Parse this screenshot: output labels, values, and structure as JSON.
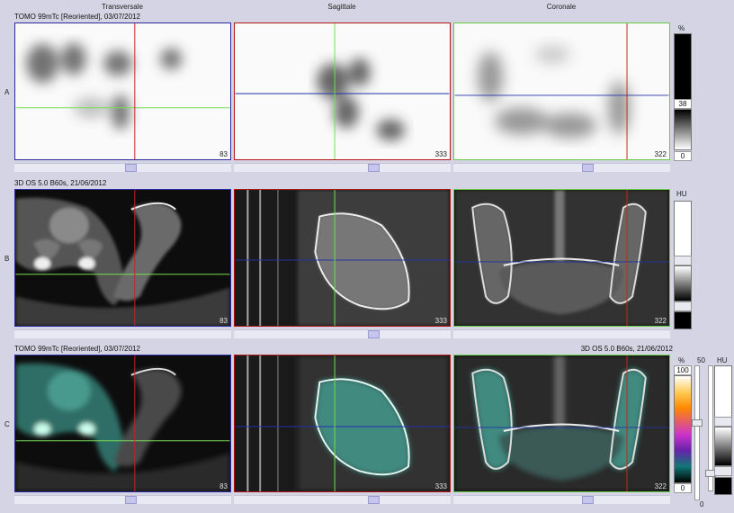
{
  "columns": {
    "transversale": "Transversale",
    "sagittale": "Sagittale",
    "coronale": "Coronale"
  },
  "row_labels": {
    "a": "A",
    "b": "B",
    "c": "C"
  },
  "series": {
    "a": "TOMO 99mTc [Reoriented], 03/07/2012",
    "b": "3D  OS  5.0  B60s, 21/06/2012",
    "c_left": "TOMO 99mTc [Reoriented], 03/07/2012",
    "c_right": "3D  OS  5.0  B60s, 21/06/2012"
  },
  "slices": {
    "a": [
      "83",
      "333",
      "322"
    ],
    "b": [
      "83",
      "333",
      "322"
    ],
    "c": [
      "83",
      "333",
      "322"
    ]
  },
  "scales": {
    "a_unit": "%",
    "a_mid": "38",
    "a_min": "0",
    "b_unit": "HU",
    "c_pct_unit": "%",
    "c_pct_max": "100",
    "c_pct_min": "0",
    "c_fusion": "50",
    "c_hu_unit": "HU",
    "c_slider_min": "0"
  },
  "colors": {
    "transversale_border": "#2b2b9e",
    "sagittale_border": "#b01818",
    "coronale_border": "#66cc44",
    "background": "#d4d4e4"
  }
}
